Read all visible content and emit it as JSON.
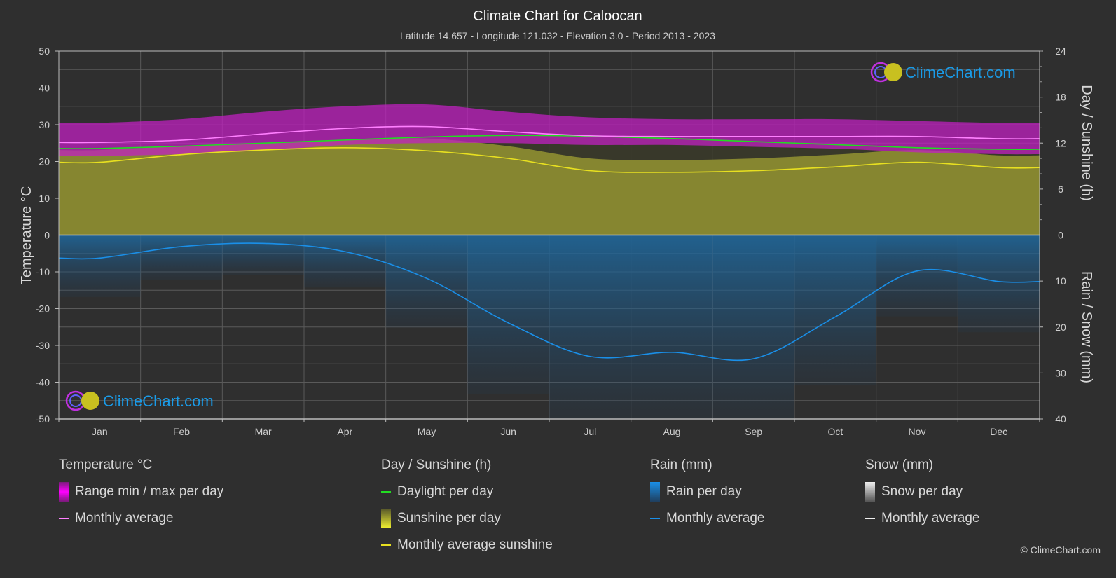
{
  "title": "Climate Chart for Caloocan",
  "subtitle": "Latitude 14.657 - Longitude 121.032 - Elevation 3.0 - Period 2013 - 2023",
  "logo_text": "ClimeChart.com",
  "copyright": "© ClimeChart.com",
  "colors": {
    "background": "#2f2f2f",
    "temp_range": "#c020c0",
    "temp_avg": "#ff80ff",
    "daylight": "#22dd22",
    "sunshine_fill": "#8a8a30",
    "sunshine_avg": "#e8e020",
    "rain_fill": "#1f5f8f",
    "rain_avg": "#1a8fe8",
    "logo_text": "#1a9be8"
  },
  "legend": {
    "temperature": {
      "title": "Temperature °C",
      "items": [
        "Range min / max per day",
        "Monthly average"
      ]
    },
    "sunshine": {
      "title": "Day / Sunshine (h)",
      "items": [
        "Daylight per day",
        "Sunshine per day",
        "Monthly average sunshine"
      ]
    },
    "rain": {
      "title": "Rain (mm)",
      "items": [
        "Rain per day",
        "Monthly average"
      ]
    },
    "snow": {
      "title": "Snow (mm)",
      "items": [
        "Snow per day",
        "Monthly average"
      ]
    }
  },
  "chart_data": {
    "type": "line",
    "title": "Climate Chart for Caloocan",
    "categories": [
      "Jan",
      "Feb",
      "Mar",
      "Apr",
      "May",
      "Jun",
      "Jul",
      "Aug",
      "Sep",
      "Oct",
      "Nov",
      "Dec"
    ],
    "left_axis": {
      "label": "Temperature °C",
      "range": [
        -50,
        50
      ],
      "ticks": [
        "50",
        "40",
        "30",
        "20",
        "10",
        "0",
        "-10",
        "-20",
        "-30",
        "-40",
        "-50"
      ]
    },
    "right_axis_top": {
      "label": "Day / Sunshine (h)",
      "range": [
        0,
        24
      ],
      "ticks": [
        "24",
        "18",
        "12",
        "6",
        "0"
      ]
    },
    "right_axis_bottom": {
      "label": "Rain / Snow (mm)",
      "range": [
        0,
        40
      ],
      "ticks": [
        "10",
        "20",
        "30",
        "40"
      ]
    },
    "grid": true,
    "series": [
      {
        "name": "Temperature monthly average (°C)",
        "axis": "temp",
        "values": [
          25.2,
          25.8,
          27.5,
          29.0,
          29.5,
          28.1,
          27.0,
          26.8,
          26.8,
          26.8,
          26.8,
          26.2
        ]
      },
      {
        "name": "Temperature daily max (°C, approx)",
        "axis": "temp",
        "values": [
          30.5,
          31.5,
          33.5,
          35.0,
          35.5,
          33.5,
          32.0,
          31.5,
          31.5,
          31.5,
          31.0,
          30.5
        ]
      },
      {
        "name": "Temperature daily min (°C, approx)",
        "axis": "temp",
        "values": [
          21.5,
          22.0,
          23.0,
          24.5,
          25.0,
          25.0,
          24.5,
          24.5,
          24.0,
          23.5,
          22.5,
          22.0
        ]
      },
      {
        "name": "Daylight per day (h)",
        "axis": "hours",
        "values": [
          11.3,
          11.6,
          12.0,
          12.4,
          12.8,
          13.0,
          12.9,
          12.6,
          12.2,
          11.8,
          11.4,
          11.2
        ]
      },
      {
        "name": "Monthly average sunshine (h)",
        "axis": "hours",
        "values": [
          9.5,
          10.5,
          11.1,
          11.4,
          11.0,
          10.0,
          8.4,
          8.2,
          8.4,
          8.9,
          9.5,
          8.8
        ]
      },
      {
        "name": "Rain monthly average (mm)",
        "axis": "rain",
        "values": [
          5.0,
          2.5,
          1.8,
          3.6,
          9.4,
          19.1,
          26.4,
          25.5,
          26.9,
          17.8,
          7.8,
          10.1
        ]
      },
      {
        "name": "Snow monthly average (mm)",
        "axis": "rain",
        "values": [
          0,
          0,
          0,
          0,
          0,
          0,
          0,
          0,
          0,
          0,
          0,
          0
        ]
      }
    ]
  }
}
